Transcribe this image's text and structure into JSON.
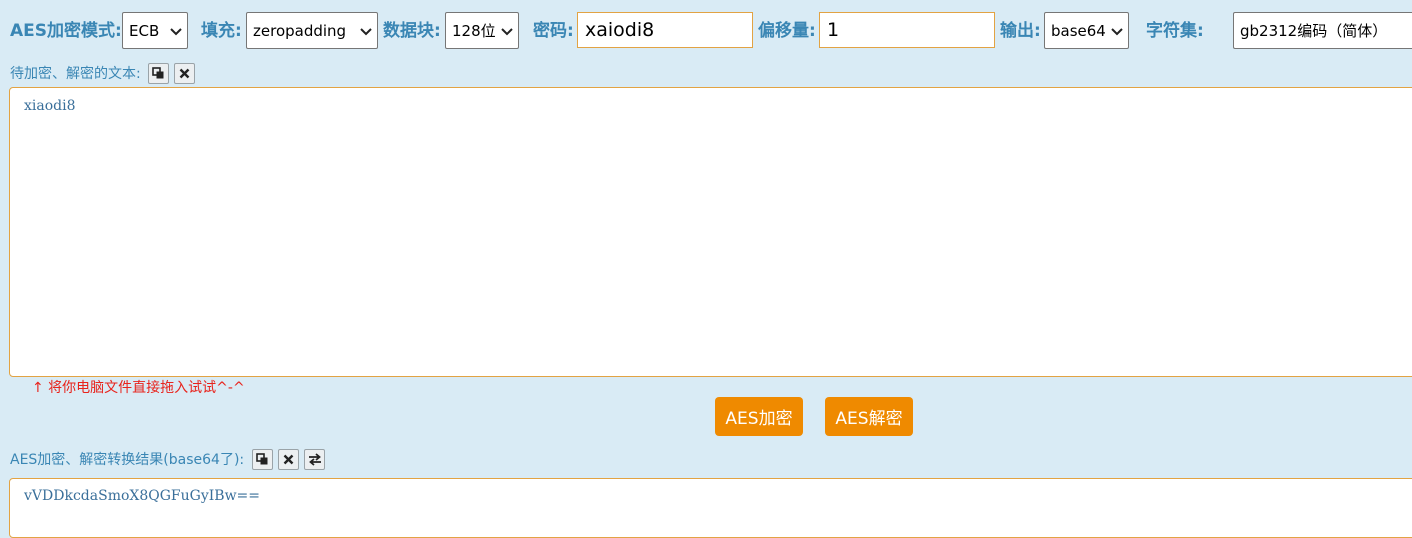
{
  "toolbar": {
    "mode_label": "AES加密模式:",
    "mode_value": "ECB",
    "padding_label": "填充:",
    "padding_value": "zeropadding",
    "block_label": "数据块:",
    "block_value": "128位",
    "password_label": "密码:",
    "password_value": "xaiodi8",
    "offset_label": "偏移量:",
    "offset_value": "1",
    "output_label": "输出:",
    "output_value": "base64",
    "charset_label": "字符集:",
    "charset_value": "gb2312编码（简体）"
  },
  "input_section": {
    "label": "待加密、解密的文本:",
    "text": "xiaodi8",
    "drag_hint": "↑ 将你电脑文件直接拖入试试^-^",
    "copy_icon": "copy-icon",
    "clear_icon": "clear-icon"
  },
  "actions": {
    "encrypt_label": "AES加密",
    "decrypt_label": "AES解密"
  },
  "result_section": {
    "label": "AES加密、解密转换结果(base64了):",
    "text": "vVDDkcdaSmoX8QGFuGyIBw==",
    "copy_icon": "copy-icon",
    "clear_icon": "clear-icon",
    "swap_icon": "swap-icon"
  },
  "colors": {
    "background": "#d9ebf5",
    "label_blue": "#3a86b4",
    "accent_orange": "#ef8a00",
    "input_border": "#e2a343",
    "hint_red": "#e8231c"
  }
}
